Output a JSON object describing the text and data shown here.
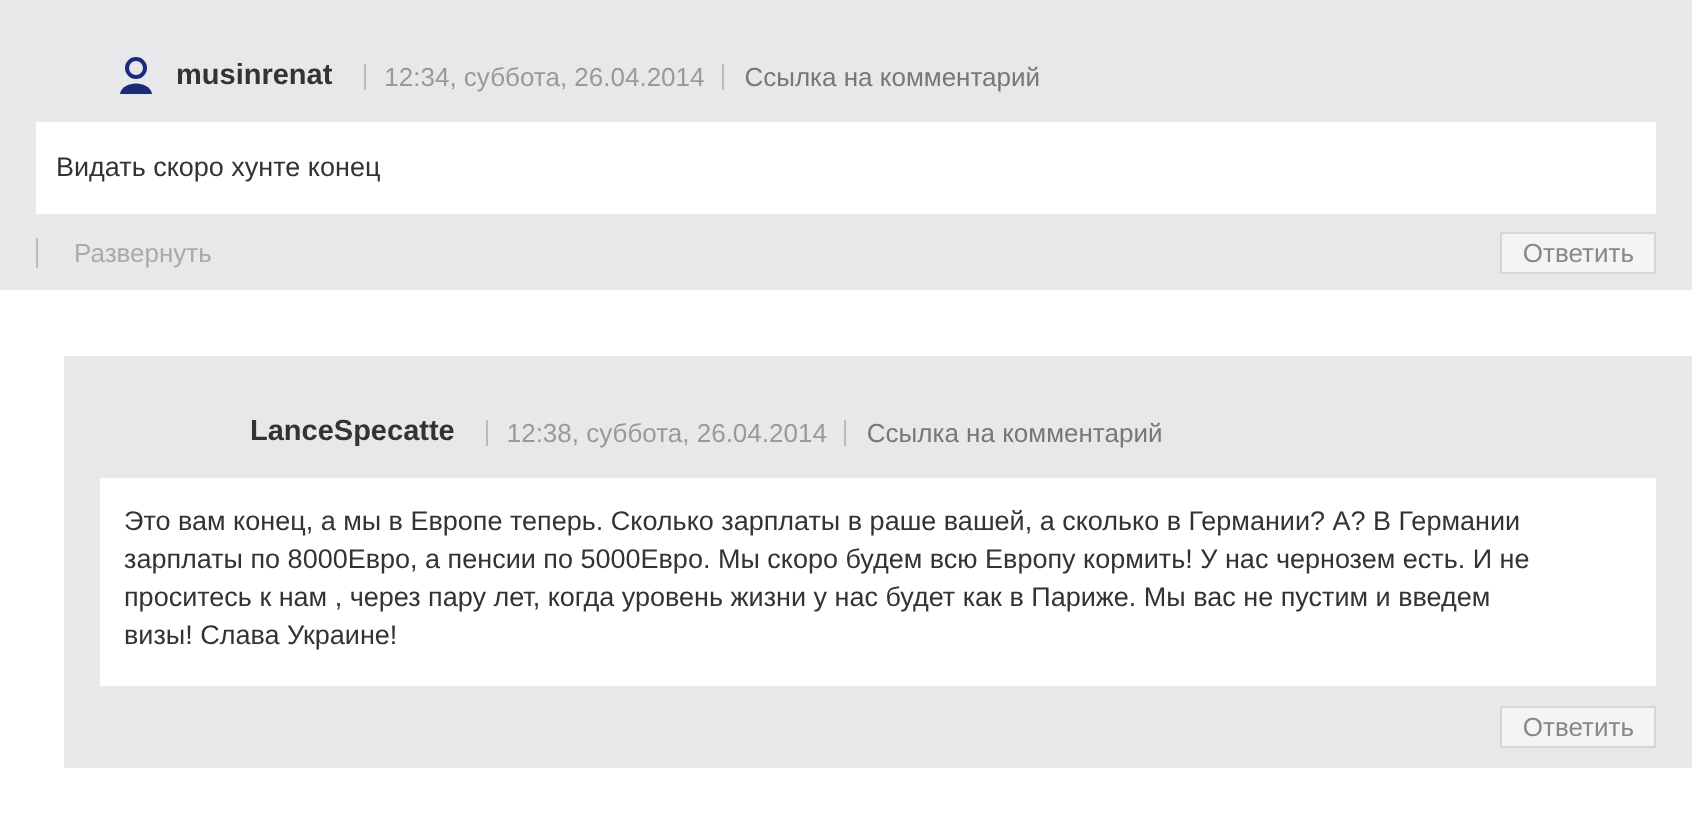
{
  "comments": [
    {
      "author": "musinrenat",
      "avatar": true,
      "time": "12:34, суббота, 26.04.2014",
      "link": "Ссылка на комментарий",
      "text": "Видать скоро хунте конец",
      "expand": "Развернуть",
      "reply": "Ответить",
      "nested": false
    },
    {
      "author": "LanceSpecatte",
      "avatar": false,
      "time": "12:38, суббота, 26.04.2014",
      "link": "Ссылка на комментарий",
      "text": "Это вам конец, а мы в Европе теперь. Сколько зарплаты в раше вашей, а сколько в Германии? А? В Германии зарплаты по 8000Евро, а пенсии по 5000Евро. Мы скоро будем всю Европу кормить! У нас чернозем есть. И не проситесь к нам , через пару лет, когда уровень жизни у нас будет как в Париже. Мы вас не пустим и введем визы! Слава Украине!",
      "reply": "Ответить",
      "nested": true
    }
  ]
}
